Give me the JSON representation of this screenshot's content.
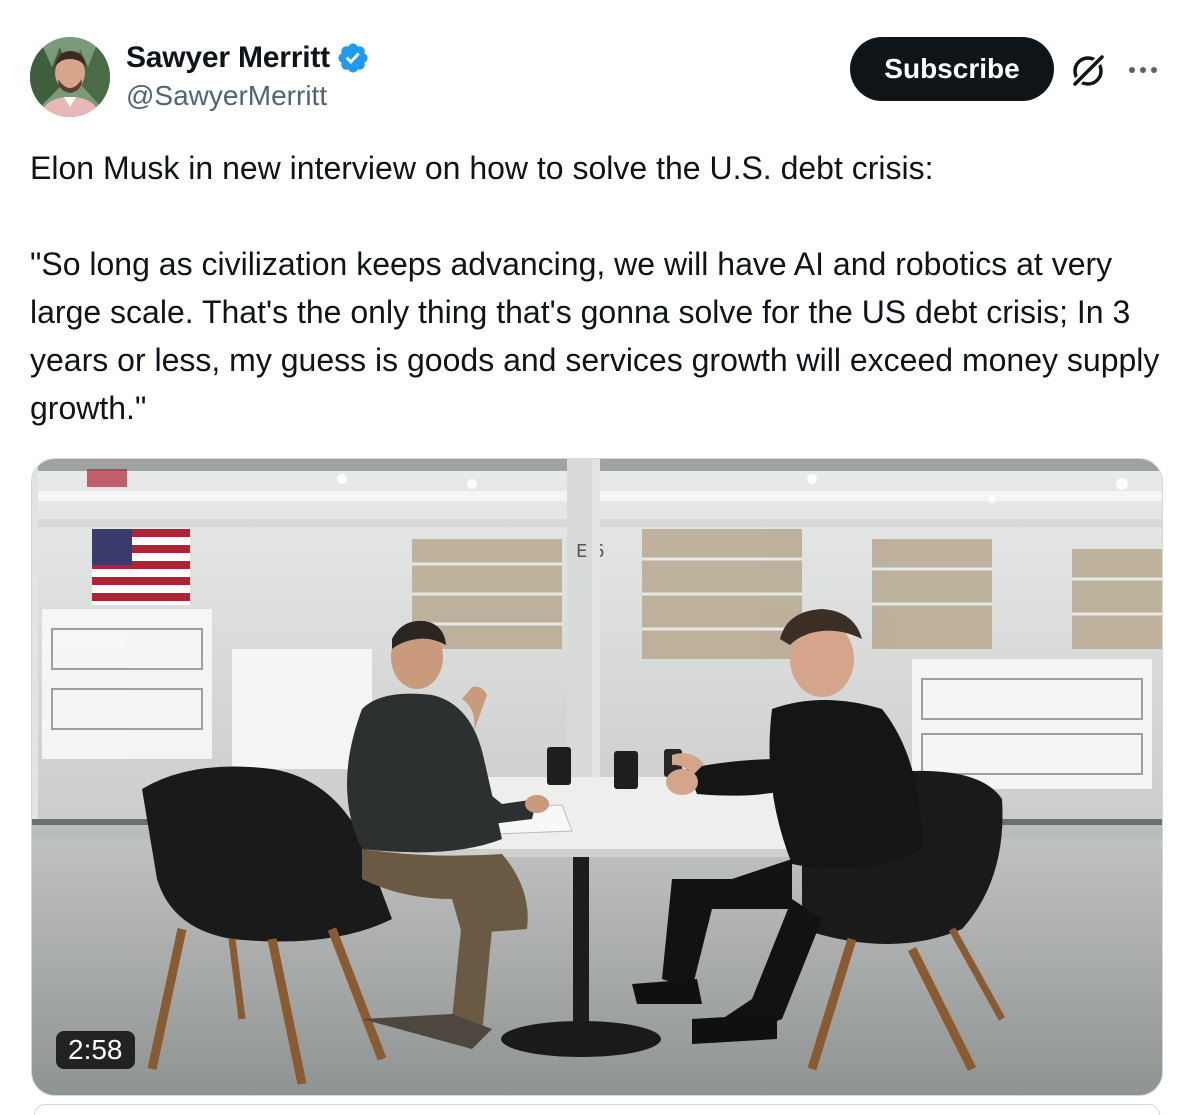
{
  "author": {
    "name": "Sawyer Merritt",
    "handle": "@SawyerMerritt",
    "verified": true,
    "avatar_icon": "avatar-photo"
  },
  "actions": {
    "subscribe_label": "Subscribe",
    "grok_icon": "grok-icon",
    "more_icon": "more-icon"
  },
  "tweet": {
    "line1": "Elon Musk in new interview on how to solve the U.S. debt crisis:",
    "quote": "\"So long as civilization keeps advancing, we will have AI and robotics at very large scale. That's the only thing that's gonna solve for the US debt crisis; In 3 years or less, my guess is goods and services growth will exceed money supply growth.\""
  },
  "media": {
    "type": "video",
    "duration": "2:58",
    "pillar_label": "E 6"
  },
  "colors": {
    "text": "#0f1419",
    "secondary": "#536471",
    "verified": "#1d9bf0",
    "button_bg": "#0f1419"
  }
}
